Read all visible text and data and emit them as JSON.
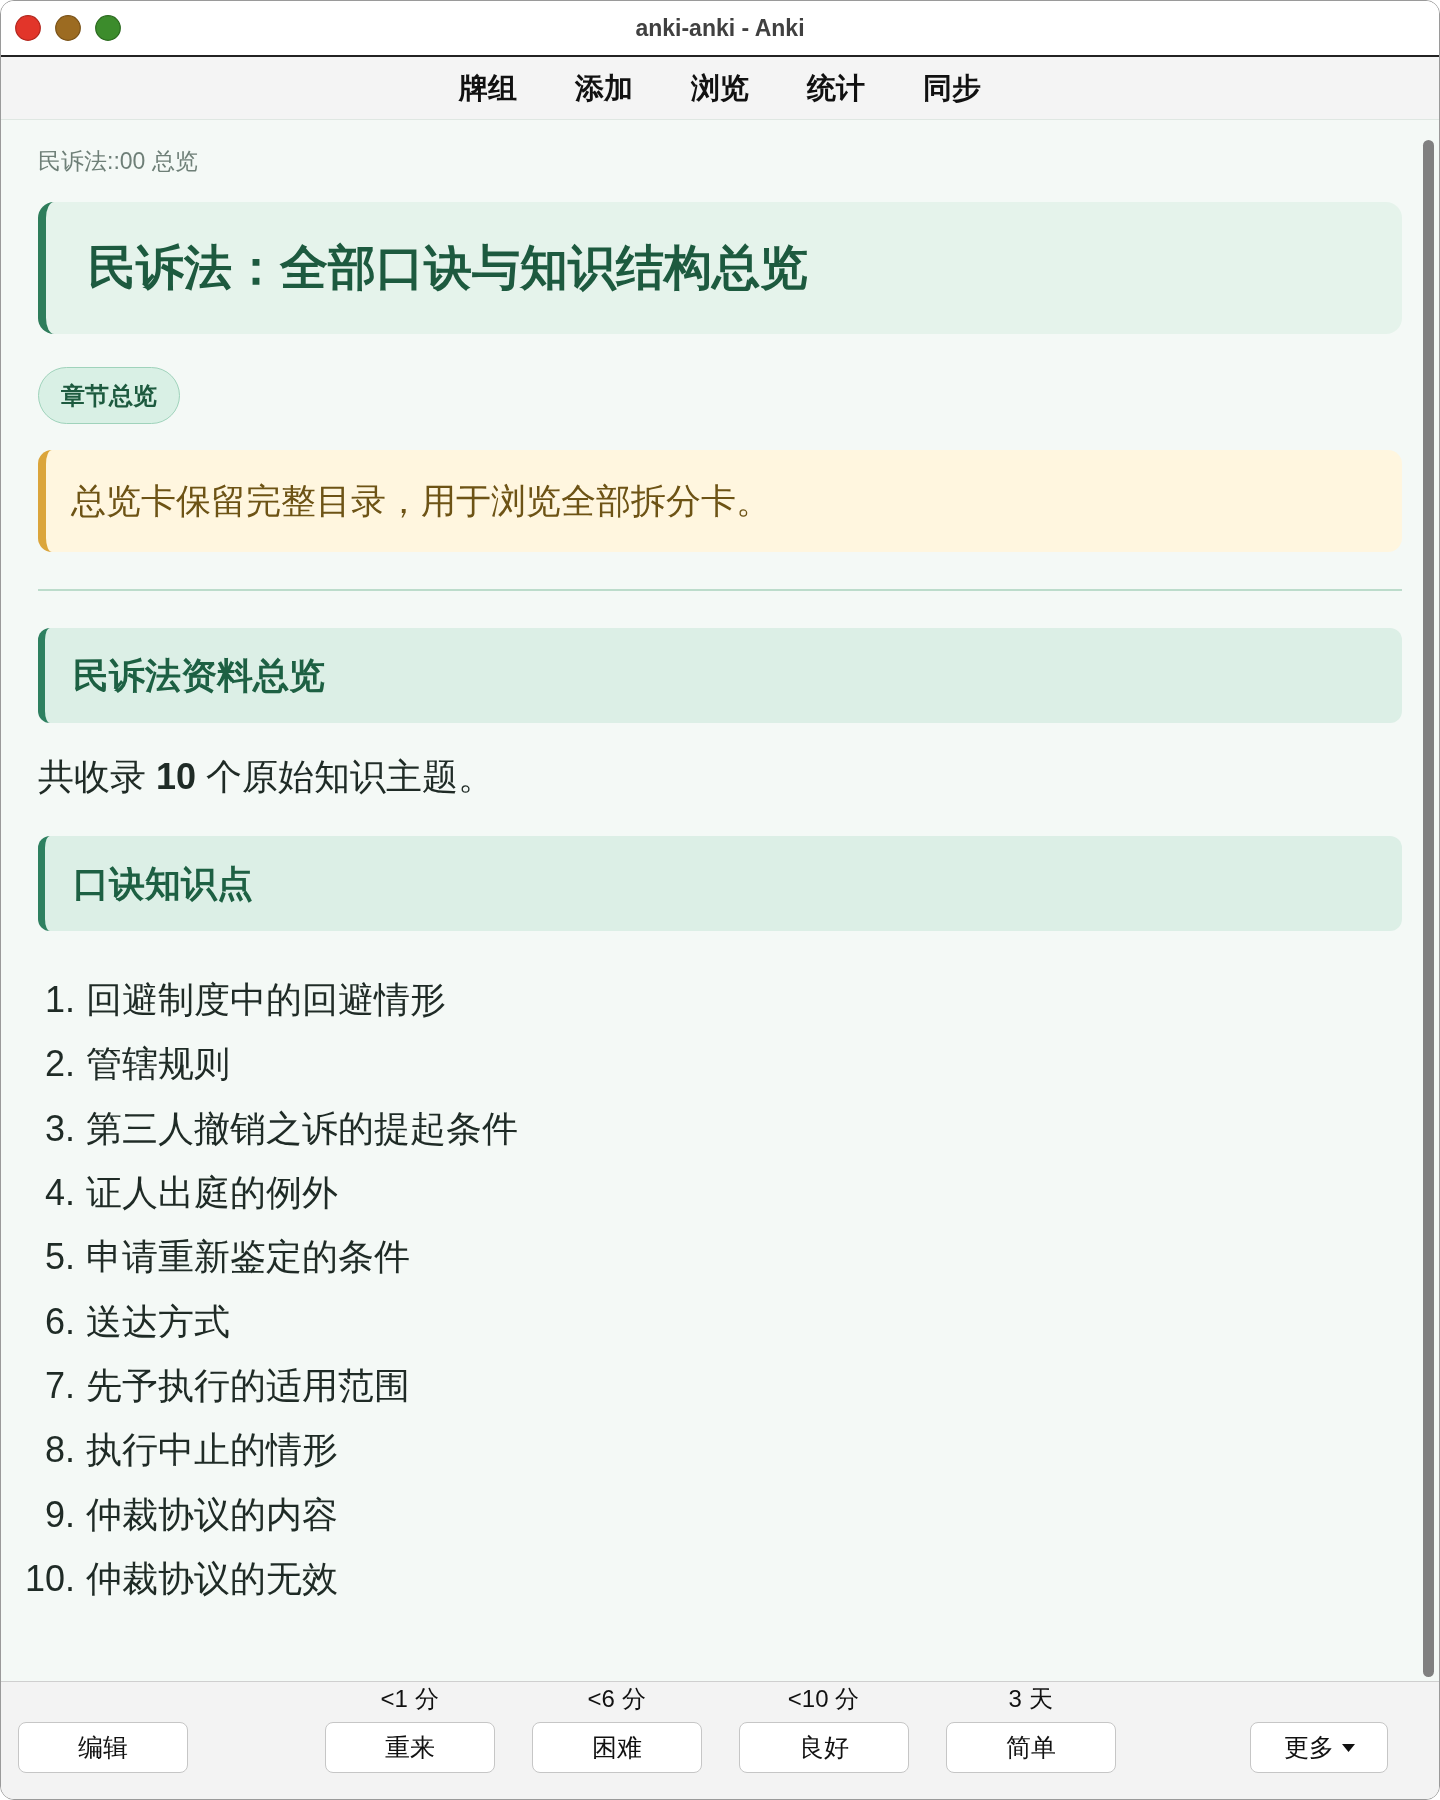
{
  "window": {
    "title": "anki-anki - Anki"
  },
  "toolbar": {
    "items": [
      "牌组",
      "添加",
      "浏览",
      "统计",
      "同步"
    ]
  },
  "card": {
    "breadcrumb": "民诉法::00 总览",
    "title": "民诉法：全部口诀与知识结构总览",
    "tag": "章节总览",
    "notice": "总览卡保留完整目录，用于浏览全部拆分卡。",
    "sections": [
      {
        "heading": "民诉法资料总览",
        "paragraph": "共收录 **10** 个原始知识主题。"
      },
      {
        "heading": "口诀知识点",
        "items": [
          {
            "number": "1.",
            "text": "回避制度中的回避情形"
          },
          {
            "number": "2.",
            "text": "管辖规则"
          },
          {
            "number": "3.",
            "text": "第三人撤销之诉的提起条件"
          },
          {
            "number": "4.",
            "text": "证人出庭的例外"
          },
          {
            "number": "5.",
            "text": "申请重新鉴定的条件"
          },
          {
            "number": "6.",
            "text": "送达方式"
          },
          {
            "number": "7.",
            "text": "先予执行的适用范围"
          },
          {
            "number": "8.",
            "text": "执行中止的情形"
          },
          {
            "number": "9.",
            "text": "仲裁协议的内容"
          },
          {
            "number": "10.",
            "text": "仲裁协议的无效"
          }
        ]
      }
    ]
  },
  "answer_bar": {
    "edit_button": "编辑",
    "answers": [
      {
        "interval": "<1 分",
        "label": "重来"
      },
      {
        "interval": "<6 分",
        "label": "困难"
      },
      {
        "interval": "<10 分",
        "label": "良好"
      },
      {
        "interval": "3 天",
        "label": "简单"
      }
    ],
    "more_button": "更多"
  }
}
